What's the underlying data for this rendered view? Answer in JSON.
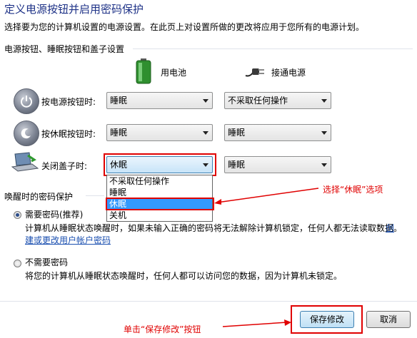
{
  "header": {
    "title": "定义电源按钮并启用密码保护",
    "subtitle": "选择要为您的计算机设置的电源设置。在此页上对设置所做的更改将应用于您所有的电源计划。"
  },
  "power_section": {
    "title": "电源按钮、睡眠按钮和盖子设置",
    "col_battery": "用电池",
    "col_plugged": "接通电源",
    "rows": [
      {
        "label": "按电源按钮时:",
        "battery": "睡眠",
        "plugged": "不采取任何操作",
        "icon": "power-button-icon"
      },
      {
        "label": "按休眠按钮时:",
        "battery": "睡眠",
        "plugged": "睡眠",
        "icon": "sleep-button-icon"
      },
      {
        "label": "关闭盖子时:",
        "battery": "休眠",
        "plugged": "睡眠",
        "icon": "laptop-lid-icon"
      }
    ],
    "dropdown_options": [
      "不采取任何操作",
      "睡眠",
      "休眠",
      "关机"
    ],
    "dropdown_selected": "休眠"
  },
  "wake_section": {
    "title": "唤醒时的密码保护",
    "require_label": "需要密码(推荐)",
    "require_desc_1": "计算机从睡眠状态唤醒时，如果未输入正确的密码将无法解除计算机锁定，任何人都无法读取数据。",
    "require_link_1": "创",
    "require_link_2": "建或更改用户帐户密码",
    "no_require_label": "不需要密码",
    "no_require_desc": "将您的计算机从睡眠状态唤醒时，任何人都可以访问您的数据，因为计算机未锁定。",
    "selected": "require"
  },
  "annotations": {
    "select_hibernate": "选择“休眠”选项",
    "click_save": "单击“保存修改”按钮"
  },
  "footer": {
    "save_label": "保存修改",
    "cancel_label": "取消"
  },
  "colors": {
    "title": "#1e3287",
    "annotation": "#e00000",
    "selection": "#3399ff",
    "link": "#1a4fb0"
  }
}
